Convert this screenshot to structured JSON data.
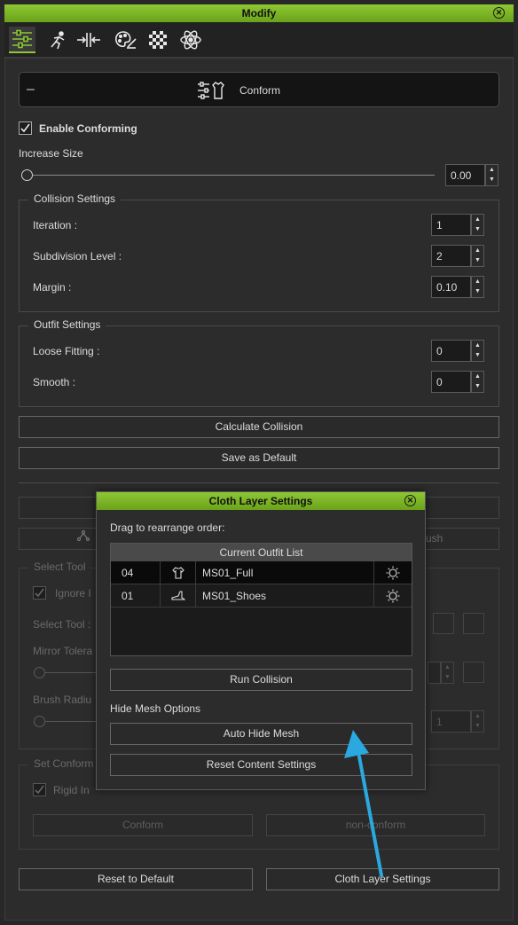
{
  "window": {
    "title": "Modify",
    "accent_color": "#7ab828"
  },
  "toolbar": {
    "icons": [
      "sliders-icon",
      "running-figure-icon",
      "squeeze-icon",
      "palette-icon",
      "checker-icon",
      "atom-icon"
    ]
  },
  "conform_section": {
    "collapse_symbol": "–",
    "title": "Conform"
  },
  "enable_conforming": {
    "label": "Enable Conforming",
    "checked": true
  },
  "increase_size": {
    "label": "Increase Size",
    "value": "0.00"
  },
  "collision_settings": {
    "title": "Collision Settings",
    "iteration_label": "Iteration :",
    "iteration_value": "1",
    "subdivision_label": "Subdivision Level :",
    "subdivision_value": "2",
    "margin_label": "Margin :",
    "margin_value": "0.10"
  },
  "outfit_settings": {
    "title": "Outfit Settings",
    "loose_label": "Loose Fitting :",
    "loose_value": "0",
    "smooth_label": "Smooth :",
    "smooth_value": "0"
  },
  "buttons": {
    "calculate_collision": "Calculate Collision",
    "save_as_default": "Save as Default",
    "reset_to_default": "Reset to Default",
    "cloth_layer_settings": "Cloth Layer Settings"
  },
  "background_panel": {
    "brush_fragment": "ush",
    "select_tool_group": "Select Tool",
    "ignore_fragment": "Ignore I",
    "select_tool_label": "Select Tool :",
    "mirror_fragment": "Mirror Tolera",
    "brush_radius_fragment": "Brush Radiu",
    "brush_radius_value": "1",
    "set_conform_group": "Set Conform",
    "rigid_fragment": "Rigid In",
    "conform_button": "Conform",
    "non_conform_button": "non-conform"
  },
  "dialog": {
    "title": "Cloth Layer Settings",
    "instruction": "Drag to rearrange order:",
    "list_header": "Current Outfit List",
    "rows": [
      {
        "order": "04",
        "icon": "shirt-icon",
        "name": "MS01_Full",
        "selected": true
      },
      {
        "order": "01",
        "icon": "shoe-icon",
        "name": "MS01_Shoes",
        "selected": false
      }
    ],
    "run_collision": "Run Collision",
    "hide_mesh_label": "Hide Mesh Options",
    "auto_hide_mesh": "Auto Hide Mesh",
    "reset_content": "Reset Content Settings"
  },
  "annotation": {
    "arrow_color": "#2aa8e0"
  }
}
